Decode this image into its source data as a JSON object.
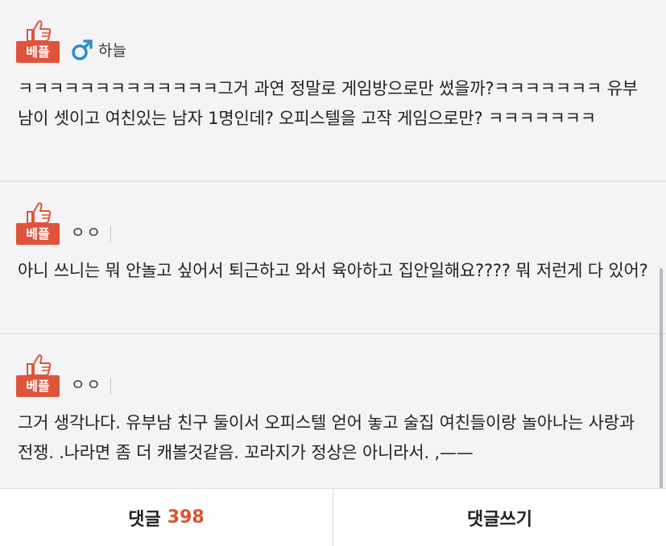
{
  "comments": [
    {
      "badge": "베플",
      "gender_icon": "male-symbol-icon",
      "nickname": "하늘",
      "text": "ㅋㅋㅋㅋㅋㅋㅋㅋㅋㅋㅋㅋㅋ그거 과연 정말로 게임방으로만 썼을까?ㅋㅋㅋㅋㅋㅋㅋ 유부남이 셋이고 여친있는 남자 1명인데? 오피스텔을 고작 게임으로만? ㅋㅋㅋㅋㅋㅋㅋ"
    },
    {
      "badge": "베플",
      "nickname": "ㅇㅇ",
      "text": "아니 쓰니는 뭐 안놀고 싶어서 퇴근하고 와서 육아하고 집안일해요???? 뭐 저런게 다 있어?"
    },
    {
      "badge": "베플",
      "nickname": "ㅇㅇ",
      "text": "그거 생각나다. 유부남 친구 둘이서 오피스텔 얻어 놓고 술집 여친들이랑 놀아나는 사랑과 전쟁. .나라면 좀 더 캐볼것같음. 꼬라지가 정상은 아니라서. ,——"
    }
  ],
  "bottom_bar": {
    "comments_label": "댓글",
    "comments_count": "398",
    "write_label": "댓글쓰기"
  },
  "colors": {
    "badge": "#e0533b",
    "count": "#d9532f",
    "male_icon": "#2a8fd0",
    "background": "#f4f4f6"
  }
}
